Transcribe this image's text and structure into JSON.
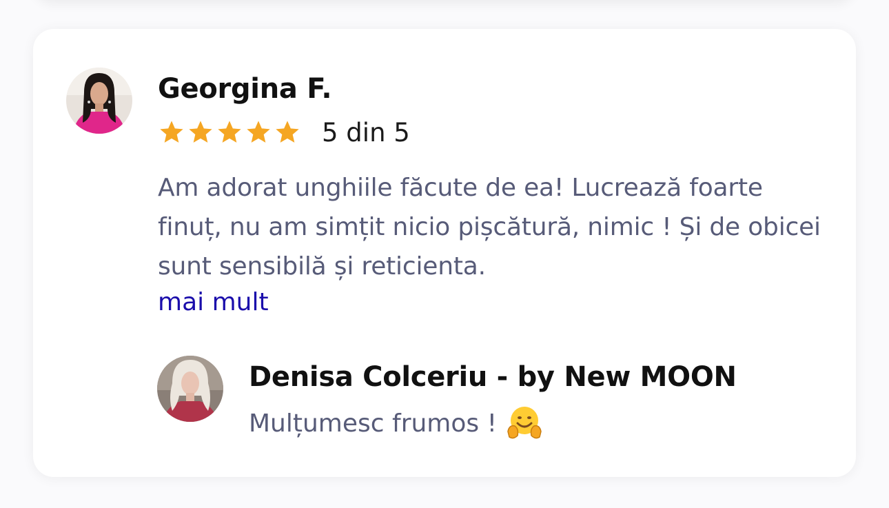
{
  "review": {
    "reviewer_name": "Georgina F.",
    "rating": 5,
    "rating_text": "5 din 5",
    "text": "Am adorat unghiile făcute de ea! Lucrează foarte finuț, nu am simțit nicio pișcătură, nimic ! Și de obicei sunt sensibilă și reticienta.",
    "more_label": "mai mult"
  },
  "owner_reply": {
    "name": "Denisa Colceriu - by New MOON",
    "text": "Mulțumesc frumos !",
    "emoji_icon": "hugging-face-icon"
  },
  "colors": {
    "star": "#f5a623",
    "link": "#1a0dab",
    "body_text": "#575b78",
    "name_text": "#111111"
  }
}
